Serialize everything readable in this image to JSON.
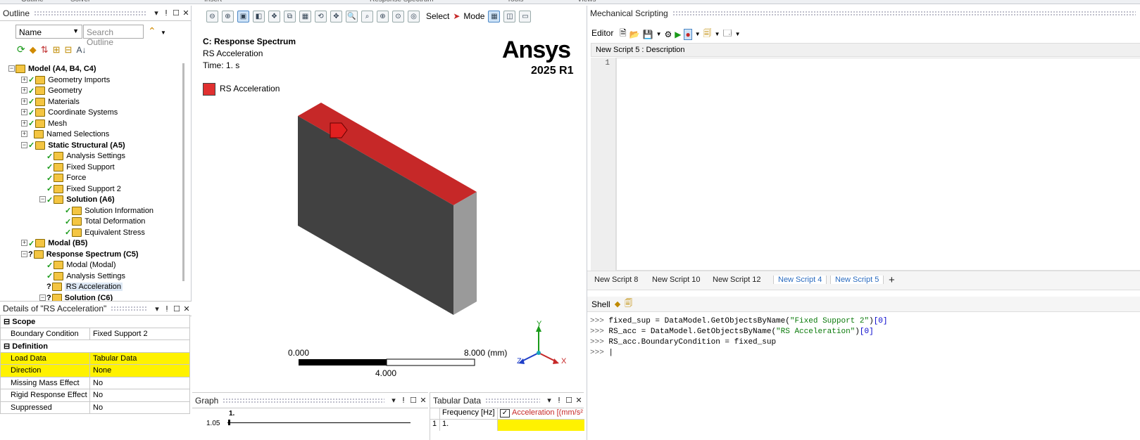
{
  "top_strip": [
    "Outline",
    "Solver",
    "Insert",
    "Response Spectrum",
    "Tools",
    "Views"
  ],
  "outline": {
    "title": "Outline",
    "filter_label": "Name",
    "search_placeholder": "Search Outline",
    "tree": [
      {
        "label": "Model (A4, B4, C4)",
        "bold": true,
        "indent": 0,
        "mark": ""
      },
      {
        "label": "Geometry Imports",
        "bold": false,
        "indent": 1,
        "mark": "check"
      },
      {
        "label": "Geometry",
        "bold": false,
        "indent": 1,
        "mark": "check"
      },
      {
        "label": "Materials",
        "bold": false,
        "indent": 1,
        "mark": "check"
      },
      {
        "label": "Coordinate Systems",
        "bold": false,
        "indent": 1,
        "mark": "check"
      },
      {
        "label": "Mesh",
        "bold": false,
        "indent": 1,
        "mark": "check"
      },
      {
        "label": "Named Selections",
        "bold": false,
        "indent": 1,
        "mark": ""
      },
      {
        "label": "Static Structural (A5)",
        "bold": true,
        "indent": 1,
        "mark": "check"
      },
      {
        "label": "Analysis Settings",
        "bold": false,
        "indent": 2,
        "mark": "check"
      },
      {
        "label": "Fixed Support",
        "bold": false,
        "indent": 2,
        "mark": "check"
      },
      {
        "label": "Force",
        "bold": false,
        "indent": 2,
        "mark": "check"
      },
      {
        "label": "Fixed Support 2",
        "bold": false,
        "indent": 2,
        "mark": "check"
      },
      {
        "label": "Solution (A6)",
        "bold": true,
        "indent": 2,
        "mark": "check"
      },
      {
        "label": "Solution Information",
        "bold": false,
        "indent": 3,
        "mark": "check"
      },
      {
        "label": "Total Deformation",
        "bold": false,
        "indent": 3,
        "mark": "check"
      },
      {
        "label": "Equivalent Stress",
        "bold": false,
        "indent": 3,
        "mark": "check"
      },
      {
        "label": "Modal (B5)",
        "bold": true,
        "indent": 1,
        "mark": "check"
      },
      {
        "label": "Response Spectrum (C5)",
        "bold": true,
        "indent": 1,
        "mark": "q"
      },
      {
        "label": "Modal (Modal)",
        "bold": false,
        "indent": 2,
        "mark": "check"
      },
      {
        "label": "Analysis Settings",
        "bold": false,
        "indent": 2,
        "mark": "check"
      },
      {
        "label": "RS Acceleration",
        "bold": false,
        "indent": 2,
        "mark": "q"
      },
      {
        "label": "Solution (C6)",
        "bold": true,
        "indent": 2,
        "mark": "q"
      }
    ]
  },
  "details": {
    "title": "Details of \"RS Acceleration\"",
    "rows": [
      {
        "section": "Scope"
      },
      {
        "k": "Boundary Condition",
        "v": "Fixed Support 2",
        "hl": false
      },
      {
        "section": "Definition"
      },
      {
        "k": "Load Data",
        "v": "Tabular Data",
        "hl": true
      },
      {
        "k": "Direction",
        "v": "None",
        "hl": true
      },
      {
        "k": "Missing Mass Effect",
        "v": "No",
        "hl": false
      },
      {
        "k": "Rigid Response Effect",
        "v": "No",
        "hl": false
      },
      {
        "k": "Suppressed",
        "v": "No",
        "hl": false
      }
    ]
  },
  "viewport": {
    "toolbar": {
      "select_label": "Select",
      "mode_label": "Mode"
    },
    "title": "C: Response Spectrum",
    "subtitle": "RS Acceleration",
    "time": "Time: 1. s",
    "legend": "RS Acceleration",
    "legend_color": "#e03030",
    "brand": "Ansys",
    "version": "2025 R1",
    "scale": {
      "left": "0.000",
      "right": "8.000 (mm)",
      "mid": "4.000"
    },
    "axes": {
      "x": "X",
      "y": "Y",
      "z": "Z"
    }
  },
  "graph": {
    "title": "Graph",
    "peak_label": "1.",
    "y_tick": "1.05"
  },
  "tabular": {
    "title": "Tabular Data",
    "col1": "Frequency [Hz]",
    "col2": "Acceleration [(mm/s²",
    "row_num": "1",
    "row_val": "1."
  },
  "scripting": {
    "title": "Mechanical Scripting",
    "editor_label": "Editor",
    "desc": "New Script 5 : Description",
    "line": "1",
    "tabs": [
      {
        "label": "New Script 8",
        "active": false
      },
      {
        "label": "New Script 10",
        "active": false
      },
      {
        "label": "New Script 12",
        "active": false
      },
      {
        "label": "New Script 4",
        "active": true
      },
      {
        "label": "New Script 5",
        "active": true
      }
    ],
    "add_tab": "+",
    "shell_label": "Shell",
    "shell_prompt": ">>>",
    "shell_lines": [
      {
        "a": "fixed_sup = DataModel.GetObjectsByName(",
        "s": "\"Fixed Support 2\"",
        "b": ")",
        "n": "[0]"
      },
      {
        "a": "RS_acc = DataModel.GetObjectsByName(",
        "s": "\"RS Acceleration\"",
        "b": ")",
        "n": "[0]"
      },
      {
        "a": "RS_acc.BoundaryCondition = fixed_sup",
        "s": "",
        "b": "",
        "n": ""
      }
    ]
  }
}
